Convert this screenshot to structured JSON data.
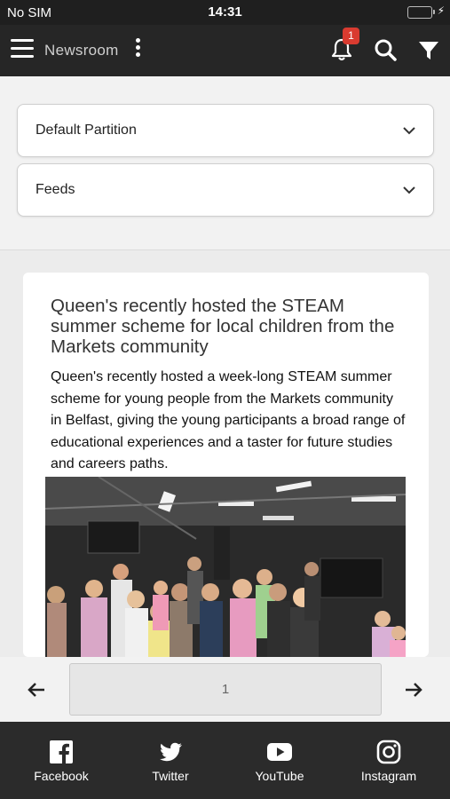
{
  "status_bar": {
    "carrier": "No SIM",
    "time": "14:31"
  },
  "header": {
    "title": "Newsroom",
    "notification_count": "1"
  },
  "filters": [
    {
      "label": "Default Partition"
    },
    {
      "label": "Feeds"
    }
  ],
  "article": {
    "title": "Queen's recently hosted the STEAM summer scheme for local children from the Markets community",
    "body": "Queen's recently hosted a week-long STEAM summer scheme for young people from the Markets community in Belfast, giving the young participants a broad range of educational experiences and a taster for future studies and careers paths."
  },
  "pagination": {
    "current_page": "1"
  },
  "footer": {
    "links": [
      {
        "label": "Facebook",
        "icon": "facebook-icon"
      },
      {
        "label": "Twitter",
        "icon": "twitter-icon"
      },
      {
        "label": "YouTube",
        "icon": "youtube-icon"
      },
      {
        "label": "Instagram",
        "icon": "instagram-icon"
      }
    ]
  },
  "colors": {
    "header_bg": "#262626",
    "footer_bg": "#2b2b2b",
    "badge": "#d93b30",
    "battery": "#34c759"
  }
}
